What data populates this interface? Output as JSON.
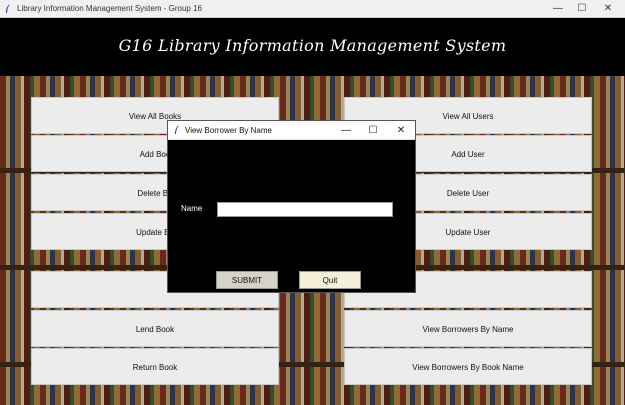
{
  "window": {
    "title": "Library Information Management System - Group 16",
    "min_glyph": "—",
    "max_glyph": "☐",
    "close_glyph": "✕"
  },
  "header": {
    "heading": "G16 Library Information Management System"
  },
  "left_menu": [
    {
      "label": "View All Books"
    },
    {
      "label": "Add Boo"
    },
    {
      "label": "Delete Bo"
    },
    {
      "label": "Update Bo"
    },
    {
      "label": ""
    },
    {
      "label": "Lend Book"
    },
    {
      "label": "Return Book"
    }
  ],
  "right_menu": [
    {
      "label": "View All Users"
    },
    {
      "label": "Add User"
    },
    {
      "label": "Delete User"
    },
    {
      "label": "Update User"
    },
    {
      "label": ""
    },
    {
      "label": "View Borrowers By Name"
    },
    {
      "label": "View Borrowers By Book Name"
    }
  ],
  "dialog": {
    "title": "View Borrower By Name",
    "min_glyph": "—",
    "max_glyph": "☐",
    "close_glyph": "✕",
    "name_label": "Name",
    "name_value": "",
    "submit_label": "SUBMIT",
    "quit_label": "Quit"
  }
}
